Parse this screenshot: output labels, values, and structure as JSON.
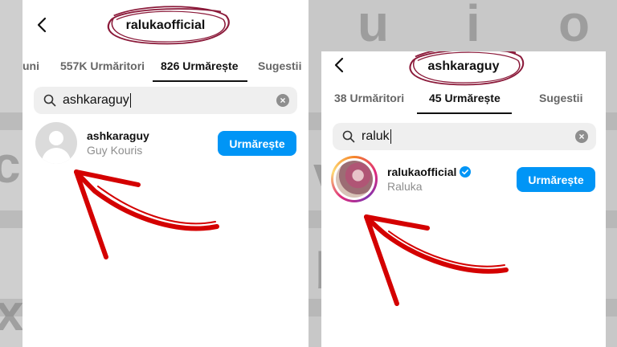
{
  "left": {
    "title": "ralukaofficial",
    "tabs": [
      "uni",
      "557K Urmăritori",
      "826 Urmărește",
      "Sugestii"
    ],
    "active_tab": "826 Urmărește",
    "search": {
      "value": "ashkaraguy",
      "clear_label": "×"
    },
    "result": {
      "username": "ashkaraguy",
      "fullname": "Guy Kouris",
      "verified": false
    },
    "follow_label": "Urmărește"
  },
  "right": {
    "title": "ashkaraguy",
    "tabs": [
      "38 Urmăritori",
      "45 Urmărește",
      "Sugestii"
    ],
    "active_tab": "45 Urmărește",
    "search": {
      "value": "raluk",
      "clear_label": "×"
    },
    "result": {
      "username": "ralukaofficial",
      "fullname": "Raluka",
      "verified": true
    },
    "follow_label": "Urmărește"
  },
  "background_keys": [
    "u",
    "i",
    "o",
    "c",
    "v",
    "b",
    "x"
  ],
  "colors": {
    "accent": "#0095f6",
    "arrow": "#d40000",
    "circle": "#8b1a3a"
  },
  "icons": [
    "back-chevron-icon",
    "search-icon",
    "clear-icon",
    "verified-badge-icon",
    "default-avatar-icon"
  ]
}
